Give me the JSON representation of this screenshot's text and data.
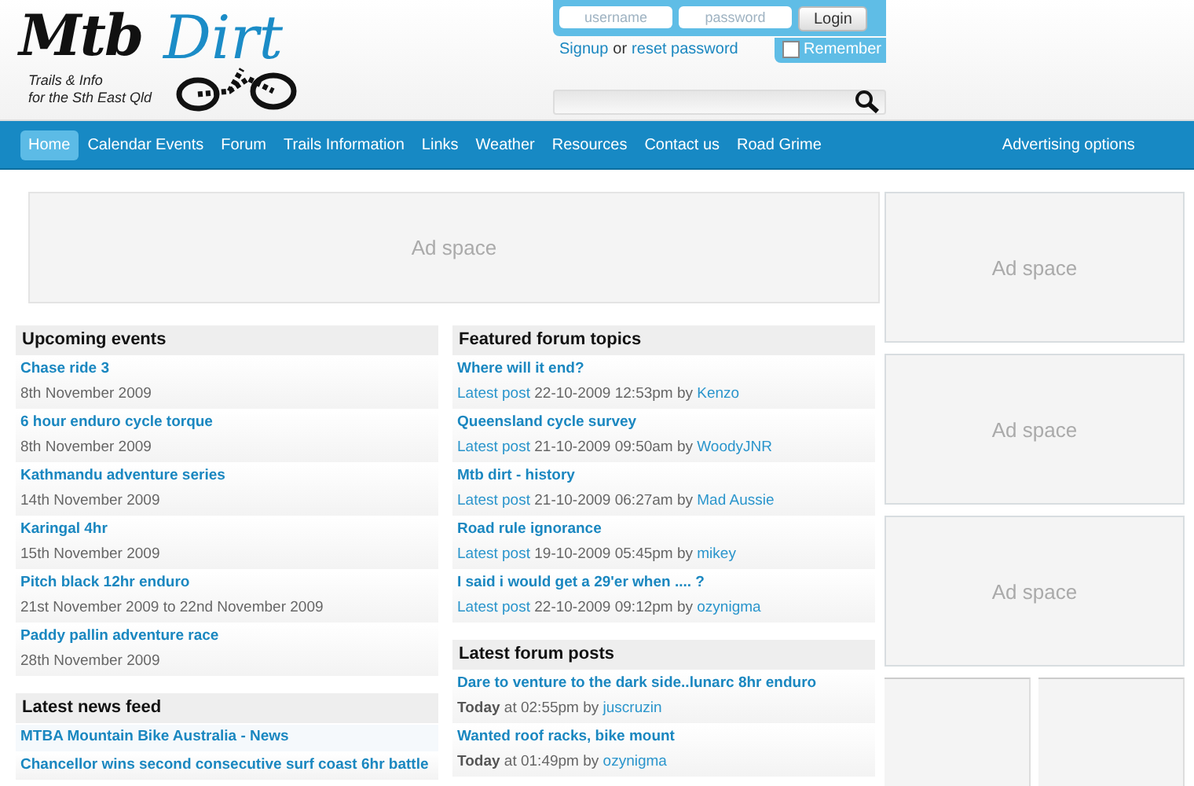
{
  "logo": {
    "word1": "Mtb",
    "word2": "Dirt",
    "tagline": [
      "Trails & Info",
      "for the Sth East Qld"
    ]
  },
  "login": {
    "username_placeholder": "username",
    "password_placeholder": "password",
    "button": "Login",
    "signup": "Signup",
    "or": "or",
    "reset": "reset password",
    "remember": {
      "label": "Remember",
      "checked": false
    }
  },
  "nav": {
    "items": [
      {
        "label": "Home",
        "selected": true
      },
      {
        "label": "Calendar Events",
        "selected": false
      },
      {
        "label": "Forum",
        "selected": false
      },
      {
        "label": "Trails Information",
        "selected": false
      },
      {
        "label": "Links",
        "selected": false
      },
      {
        "label": "Weather",
        "selected": false
      },
      {
        "label": "Resources",
        "selected": false
      },
      {
        "label": "Contact us",
        "selected": false
      },
      {
        "label": "Road Grime",
        "selected": false
      }
    ],
    "right": "Advertising options"
  },
  "banner_ad": {
    "label": "Ad space"
  },
  "side_ads": [
    {
      "label": "Ad space"
    },
    {
      "label": "Ad space"
    },
    {
      "label": "Ad space"
    }
  ],
  "upcoming_events": {
    "title": "Upcoming events",
    "items": [
      {
        "name": "Chase ride 3",
        "date": "8th November 2009"
      },
      {
        "name": "6 hour enduro cycle torque",
        "date": "8th November 2009"
      },
      {
        "name": "Kathmandu adventure series",
        "date": "14th November 2009"
      },
      {
        "name": "Karingal 4hr",
        "date": "15th November 2009"
      },
      {
        "name": "Pitch black 12hr enduro",
        "date": "21st November 2009 to 22nd November 2009"
      },
      {
        "name": "Paddy pallin adventure race",
        "date": "28th November 2009"
      }
    ]
  },
  "news_feed": {
    "title": "Latest news feed",
    "items": [
      {
        "kind": "feed",
        "text": "MTBA Mountain Bike Australia - News"
      },
      {
        "kind": "item",
        "text": "Chancellor wins second consecutive surf coast 6hr battle"
      }
    ]
  },
  "featured_topics": {
    "title": "Featured forum topics",
    "items": [
      {
        "title": "Where will it end?",
        "label": "Latest post",
        "text": "22-10-2009 12:53pm by",
        "user": "Kenzo"
      },
      {
        "title": "Queensland cycle survey",
        "label": "Latest post",
        "text": "21-10-2009 09:50am by",
        "user": "WoodyJNR"
      },
      {
        "title": "Mtb dirt - history",
        "label": "Latest post",
        "text": "21-10-2009 06:27am by",
        "user": "Mad Aussie"
      },
      {
        "title": "Road rule ignorance",
        "label": "Latest post",
        "text": "19-10-2009 05:45pm by",
        "user": "mikey"
      },
      {
        "title": "I said i would get a 29'er when .... ?",
        "label": "Latest post",
        "text": "22-10-2009 09:12pm by",
        "user": "ozynigma"
      }
    ]
  },
  "latest_posts": {
    "title": "Latest forum posts",
    "items": [
      {
        "title": "Dare to venture to the dark side..lunarc 8hr enduro",
        "text": "**Today** at 02:55pm by",
        "user": "juscruzin"
      },
      {
        "title": "Wanted roof racks, bike mount",
        "text": "**Today** at 01:49pm by",
        "user": "ozynigma"
      }
    ]
  }
}
